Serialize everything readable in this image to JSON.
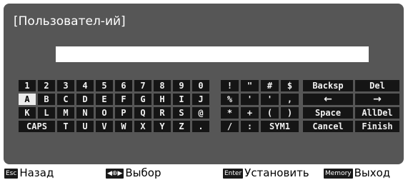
{
  "dialog": {
    "title": "[Пользовател-ий]",
    "input": {
      "value": "",
      "placeholder": ""
    }
  },
  "keyboard": {
    "selected_key": "A",
    "alnum_rows": [
      [
        "1",
        "2",
        "3",
        "4",
        "5",
        "6",
        "7",
        "8",
        "9",
        "0"
      ],
      [
        "A",
        "B",
        "C",
        "D",
        "E",
        "F",
        "G",
        "H",
        "I",
        "J"
      ],
      [
        "K",
        "L",
        "M",
        "N",
        "O",
        "P",
        "Q",
        "R",
        "S",
        "@"
      ],
      [
        "CAPS",
        "T",
        "U",
        "V",
        "W",
        "X",
        "Y",
        "Z",
        "."
      ]
    ],
    "symbol_rows": [
      [
        "!",
        "\"",
        "#",
        "$"
      ],
      [
        "%",
        "'",
        "'",
        ","
      ],
      [
        "*",
        "+",
        "(",
        ")"
      ],
      [
        "/",
        ":",
        "SYM1"
      ]
    ],
    "function_keys": {
      "backspace": "Backsp",
      "delete": "Del",
      "cursor_left": "←",
      "cursor_right": "→",
      "space": "Space",
      "all_delete": "AllDel",
      "cancel": "Cancel",
      "finish": "Finish"
    }
  },
  "footer": {
    "hints": [
      {
        "badge": "Esc",
        "label": "Назад",
        "icon": "esc-badge"
      },
      {
        "badge": "◀⊕▶",
        "label": "Выбор",
        "icon": "select-arrows-badge"
      },
      {
        "badge": "Enter",
        "label": "Установить",
        "icon": "enter-badge"
      },
      {
        "badge": "Memory",
        "label": "Выход",
        "icon": "memory-badge"
      }
    ]
  },
  "colors": {
    "panel": "#565656",
    "key": "#151515",
    "key_text": "#f0f0f0",
    "key_selected": "#ececec",
    "input": "#ffffff"
  }
}
